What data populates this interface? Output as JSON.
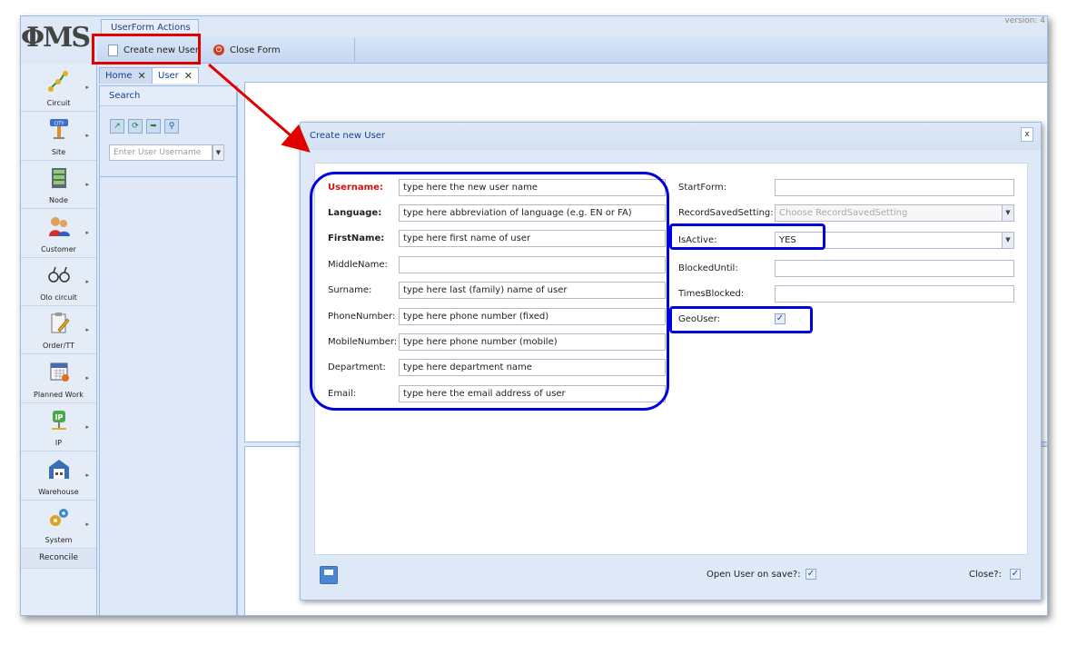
{
  "app": {
    "logo_text": "ΦMS",
    "version_text": "version: 4"
  },
  "toolbar": {
    "group_title": "UserForm Actions",
    "create_label": "Create new User",
    "close_label": "Close Form"
  },
  "sidebar": {
    "items": [
      {
        "label": "Circuit",
        "icon": "circuit-icon"
      },
      {
        "label": "Site",
        "icon": "city-sign-icon"
      },
      {
        "label": "Node",
        "icon": "node-rack-icon"
      },
      {
        "label": "Customer",
        "icon": "customer-users-icon"
      },
      {
        "label": "Olo circuit",
        "icon": "olo-circuit-icon"
      },
      {
        "label": "Order/TT",
        "icon": "clipboard-pencil-icon"
      },
      {
        "label": "Planned Work",
        "icon": "calendar-icon"
      },
      {
        "label": "IP",
        "icon": "ip-icon"
      },
      {
        "label": "Warehouse",
        "icon": "warehouse-icon"
      },
      {
        "label": "System",
        "icon": "gears-icon"
      }
    ],
    "reconcile_label": "Reconcile"
  },
  "tabs": {
    "home": "Home",
    "user": "User"
  },
  "search": {
    "title": "Search",
    "placeholder": "Enter User Username"
  },
  "dialog": {
    "title": "Create new User",
    "close_glyph": "x",
    "left_fields": [
      {
        "label": "Username:",
        "value": "type here the new user name"
      },
      {
        "label": "Language:",
        "value": "type here abbreviation of language (e.g. EN or FA)"
      },
      {
        "label": "FirstName:",
        "value": "type here first name of user"
      },
      {
        "label": "MiddleName:",
        "value": ""
      },
      {
        "label": "Surname:",
        "value": "type here last (family) name of user"
      },
      {
        "label": "PhoneNumber:",
        "value": "type here phone number (fixed)"
      },
      {
        "label": "MobileNumber:",
        "value": "type here phone number (mobile)"
      },
      {
        "label": "Department:",
        "value": "type here department name"
      },
      {
        "label": "Email:",
        "value": "type here the email address of user"
      }
    ],
    "right_fields": {
      "start_form": {
        "label": "StartForm:",
        "value": ""
      },
      "record_saved_setting": {
        "label": "RecordSavedSetting:",
        "placeholder": "Choose RecordSavedSetting"
      },
      "is_active": {
        "label": "IsActive:",
        "value": "YES"
      },
      "blocked_until": {
        "label": "BlockedUntil:",
        "value": ""
      },
      "times_blocked": {
        "label": "TimesBlocked:",
        "value": ""
      },
      "geo_user": {
        "label": "GeoUser:",
        "checked": true
      }
    },
    "footer": {
      "open_on_save_label": "Open User on save?:",
      "open_on_save_checked": true,
      "close_label": "Close?:",
      "close_checked": true
    }
  },
  "colors": {
    "annotation_red": "#e00000",
    "annotation_blue": "#0000dd",
    "required_label": "#d01010",
    "panel_bg": "#dfe8f6",
    "border": "#99bbe8"
  }
}
